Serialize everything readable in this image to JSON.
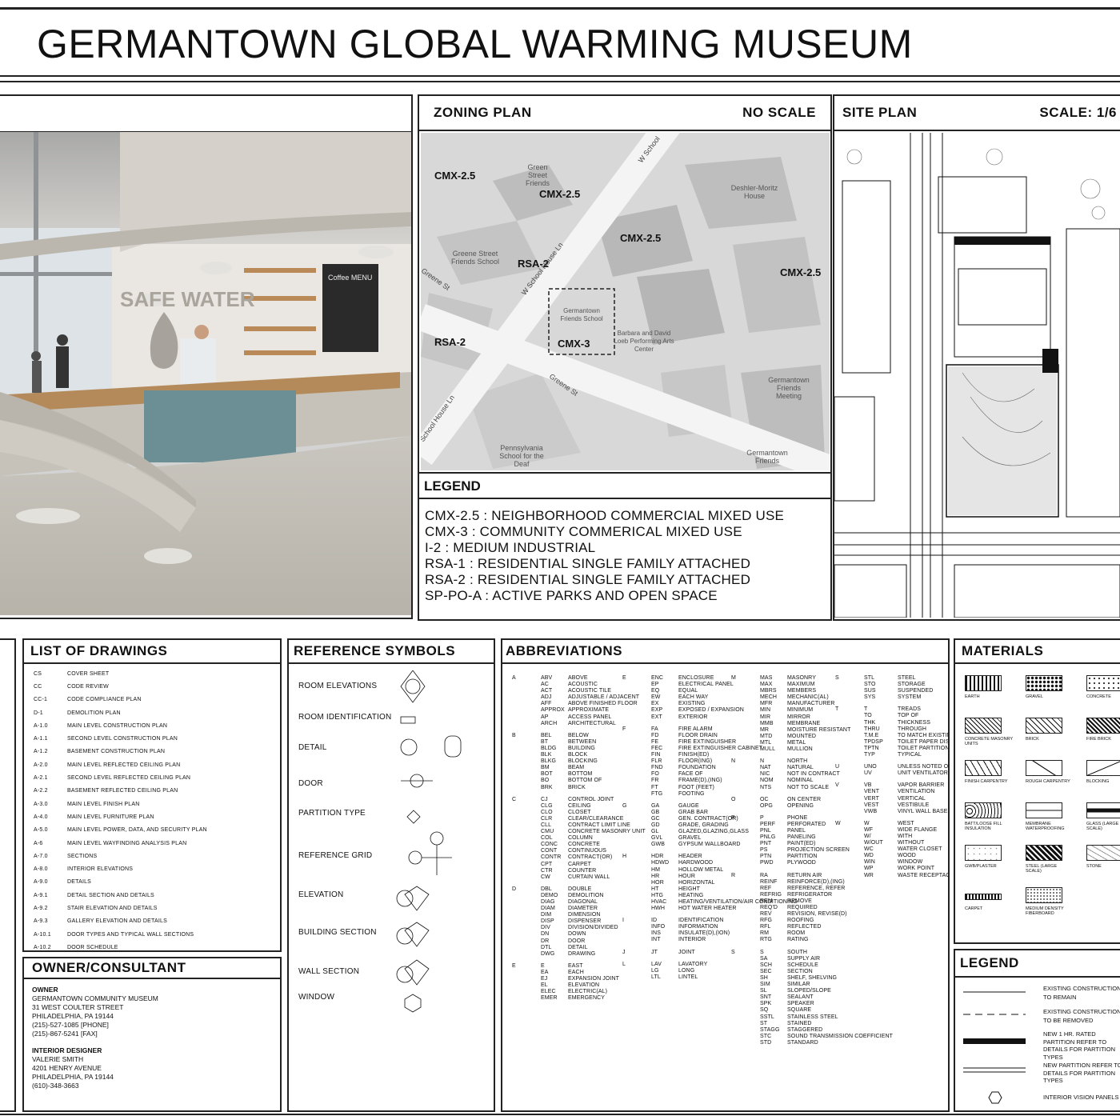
{
  "title": "GERMANTOWN GLOBAL WARMING MUSEUM",
  "zoning": {
    "title": "ZONING PLAN",
    "scale": "NO SCALE",
    "zones": [
      "CMX-2.5",
      "CMX-2.5",
      "CMX-2.5",
      "CMX-2.5",
      "RSA-2",
      "RSA-2",
      "CMX-3"
    ],
    "places": [
      "Green Street Friends",
      "Greene Street Friends School",
      "Deshler-Moritz House",
      "Germantown Friends School",
      "Barbara and David Loeb Performing Arts Center",
      "Germantown Friends Meeting",
      "Germantown Friends",
      "Pennsylvania School for the Deaf"
    ],
    "streets": [
      "W School House Ln",
      "Greene St",
      "Greene St",
      "School House Ln",
      "W School"
    ],
    "legend_title": "LEGEND",
    "legend": [
      "CMX-2.5 : NEIGHBORHOOD COMMERCIAL MIXED USE",
      "CMX-3 : COMMUNITY COMMERICAL MIXED USE",
      "I-2 : MEDIUM INDUSTRIAL",
      "RSA-1 : RESIDENTIAL SINGLE FAMILY ATTACHED",
      "RSA-2 : RESIDENTIAL SINGLE FAMILY ATTACHED",
      "SP-PO-A : ACTIVE PARKS AND OPEN SPACE"
    ]
  },
  "site": {
    "title": "SITE PLAN",
    "scale": "SCALE: 1/6"
  },
  "render": {
    "wall_text": "SAFE WATER",
    "menu_title": "Coffee MENU"
  },
  "drawings": {
    "title": "LIST OF DRAWINGS",
    "rows": [
      [
        "CS",
        "COVER SHEET"
      ],
      [
        "CC",
        "CODE REVIEW"
      ],
      [
        "CC-1",
        "CODE COMPLIANCE PLAN"
      ],
      [
        "D-1",
        "DEMOLITION PLAN"
      ],
      [
        "A-1.0",
        "MAIN LEVEL CONSTRUCTION PLAN"
      ],
      [
        "A-1.1",
        "SECOND LEVEL CONSTRUCTION PLAN"
      ],
      [
        "A-1.2",
        "BASEMENT CONSTRUCTION PLAN"
      ],
      [
        "A-2.0",
        "MAIN LEVEL REFLECTED CEILING PLAN"
      ],
      [
        "A-2.1",
        "SECOND LEVEL REFLECTED CEILING PLAN"
      ],
      [
        "A-2.2",
        "BASEMENT REFLECTED CEILING PLAN"
      ],
      [
        "A-3.0",
        "MAIN LEVEL FINISH PLAN"
      ],
      [
        "A-4.0",
        "MAIN LEVEL FURNITURE PLAN"
      ],
      [
        "A-5.0",
        "MAIN LEVEL POWER, DATA, AND SECURITY PLAN"
      ],
      [
        "A-6",
        "MAIN LEVEL WAYFINDING ANALYSIS PLAN"
      ],
      [
        "A-7.0",
        "SECTIONS"
      ],
      [
        "A-8.0",
        "INTERIOR ELEVATIONS"
      ],
      [
        "A-9.0",
        "DETAILS"
      ],
      [
        "A-9.1",
        "DETAIL SECTION AND DETAILS"
      ],
      [
        "A-9.2",
        "STAIR ELEVATION AND DETAILS"
      ],
      [
        "A-9.3",
        "GALLERY ELEVATION AND DETAILS"
      ],
      [
        "A-10.1",
        "DOOR TYPES AND TYPICAL WALL SECTIONS"
      ],
      [
        "A-10.2",
        "DOOR SCHEDULE"
      ]
    ]
  },
  "owner": {
    "title": "OWNER/CONSULTANT",
    "owner_label": "OWNER",
    "owner_lines": [
      "GERMANTOWN COMMUNITY MUSEUM",
      "31 WEST COULTER STREET",
      "PHILADELPHIA, PA 19144",
      "(215)-527-1085 [PHONE]",
      "(215)-867-5241 [FAX]"
    ],
    "designer_label": "INTERIOR DESIGNER",
    "designer_lines": [
      "VALERIE SMITH",
      "4201 HENRY AVENUE",
      "PHILADELPHIA, PA 19144",
      "(610)-348-3663"
    ]
  },
  "refsymbols": {
    "title": "REFERENCE SYMBOLS",
    "rows": [
      "ROOM ELEVATIONS",
      "ROOM IDENTIFICATION",
      "DETAIL",
      "DOOR",
      "PARTITION TYPE",
      "REFERENCE GRID",
      "ELEVATION",
      "BUILDING SECTION",
      "WALL SECTION",
      "WINDOW"
    ]
  },
  "abbrev": {
    "title": "ABBREVIATIONS",
    "columns": [
      [
        {
          "letter": "A",
          "items": [
            [
              "ABV",
              "ABOVE"
            ],
            [
              "AC",
              "ACOUSTIC"
            ],
            [
              "ACT",
              "ACOUSTIC TILE"
            ],
            [
              "ADJ",
              "ADJUSTABLE / ADJACENT"
            ],
            [
              "AFF",
              "ABOVE FINISHED FLOOR"
            ],
            [
              "APPROX",
              "APPROXIMATE"
            ],
            [
              "AP",
              "ACCESS PANEL"
            ],
            [
              "ARCH",
              "ARCHITECTURAL"
            ]
          ]
        },
        {
          "letter": "B",
          "items": [
            [
              "BEL",
              "BELOW"
            ],
            [
              "BT",
              "BETWEEN"
            ],
            [
              "BLDG",
              "BUILDING"
            ],
            [
              "BLK",
              "BLOCK"
            ],
            [
              "BLKG",
              "BLOCKING"
            ],
            [
              "BM",
              "BEAM"
            ],
            [
              "BOT",
              "BOTTOM"
            ],
            [
              "BO",
              "BOTTOM OF"
            ],
            [
              "BRK",
              "BRICK"
            ]
          ]
        },
        {
          "letter": "C",
          "items": [
            [
              "CJ",
              "CONTROL JOINT"
            ],
            [
              "CLG",
              "CEILING"
            ],
            [
              "CLO",
              "CLOSET"
            ],
            [
              "CLR",
              "CLEAR/CLEARANCE"
            ],
            [
              "CLL",
              "CONTRACT LIMIT LINE"
            ],
            [
              "CMU",
              "CONCRETE MASONRY UNIT"
            ],
            [
              "COL",
              "COLUMN"
            ],
            [
              "CONC",
              "CONCRETE"
            ],
            [
              "CONT",
              "CONTINUOUS"
            ],
            [
              "CONTR",
              "CONTRACT(OR)"
            ],
            [
              "CPT",
              "CARPET"
            ],
            [
              "CTR",
              "COUNTER"
            ],
            [
              "CW",
              "CURTAIN WALL"
            ]
          ]
        },
        {
          "letter": "D",
          "items": [
            [
              "DBL",
              "DOUBLE"
            ],
            [
              "DEMO",
              "DEMOLITION"
            ],
            [
              "DIAG",
              "DIAGONAL"
            ],
            [
              "DIAM",
              "DIAMETER"
            ],
            [
              "DIM",
              "DIMENSION"
            ],
            [
              "DISP",
              "DISPENSER"
            ],
            [
              "DIV",
              "DIVISION/DIVIDED"
            ],
            [
              "DN",
              "DOWN"
            ],
            [
              "DR",
              "DOOR"
            ],
            [
              "DTL",
              "DETAIL"
            ],
            [
              "DWG",
              "DRAWING"
            ]
          ]
        },
        {
          "letter": "E",
          "items": [
            [
              "E",
              "EAST"
            ],
            [
              "EA",
              "EACH"
            ],
            [
              "EJ",
              "EXPANSION JOINT"
            ],
            [
              "EL",
              "ELEVATION"
            ],
            [
              "ELEC",
              "ELECTRIC(AL)"
            ],
            [
              "EMER",
              "EMERGENCY"
            ]
          ]
        }
      ],
      [
        {
          "letter": "E",
          "items": [
            [
              "ENC",
              "ENCLOSURE"
            ],
            [
              "EP",
              "ELECTRICAL PANEL"
            ],
            [
              "EQ",
              "EQUAL"
            ],
            [
              "EW",
              "EACH WAY"
            ],
            [
              "EX",
              "EXISTING"
            ],
            [
              "EXP",
              "EXPOSED / EXPANSION"
            ],
            [
              "EXT",
              "EXTERIOR"
            ]
          ]
        },
        {
          "letter": "F",
          "items": [
            [
              "FA",
              "FIRE ALARM"
            ],
            [
              "FD",
              "FLOOR DRAIN"
            ],
            [
              "FE",
              "FIRE EXTINGUISHER"
            ],
            [
              "FEC",
              "FIRE EXTINGUISHER CABINET"
            ],
            [
              "FIN",
              "FINISH(ED)"
            ],
            [
              "FLR",
              "FLOOR(ING)"
            ],
            [
              "FND",
              "FOUNDATION"
            ],
            [
              "FO",
              "FACE OF"
            ],
            [
              "FR",
              "FRAME(D),(ING)"
            ],
            [
              "FT",
              "FOOT (FEET)"
            ],
            [
              "FTG",
              "FOOTING"
            ]
          ]
        },
        {
          "letter": "G",
          "items": [
            [
              "GA",
              "GAUGE"
            ],
            [
              "GB",
              "GRAB BAR"
            ],
            [
              "GC",
              "GEN. CONTRACT(OR)"
            ],
            [
              "GD",
              "GRADE, GRADING"
            ],
            [
              "GL",
              "GLAZED,GLAZING,GLASS"
            ],
            [
              "GVL",
              "GRAVEL"
            ],
            [
              "GWB",
              "GYPSUM WALLBOARD"
            ]
          ]
        },
        {
          "letter": "H",
          "items": [
            [
              "HDR",
              "HEADER"
            ],
            [
              "HDWD",
              "HARDWOOD"
            ],
            [
              "HM",
              "HOLLOW METAL"
            ],
            [
              "HR",
              "HOUR"
            ],
            [
              "HOR",
              "HORIZONTAL"
            ],
            [
              "HT",
              "HEIGHT"
            ],
            [
              "HTG",
              "HEATING"
            ],
            [
              "HVAC",
              "HEATING/VENTILATION/AIR CONDITIONING"
            ],
            [
              "HWH",
              "HOT WATER HEATER"
            ]
          ]
        },
        {
          "letter": "I",
          "items": [
            [
              "ID",
              "IDENTIFICATION"
            ],
            [
              "INFO",
              "INFORMATION"
            ],
            [
              "INS",
              "INSULATE(D),(ION)"
            ],
            [
              "INT",
              "INTERIOR"
            ]
          ]
        },
        {
          "letter": "J",
          "items": [
            [
              "JT",
              "JOINT"
            ]
          ]
        },
        {
          "letter": "L",
          "items": [
            [
              "LAV",
              "LAVATORY"
            ],
            [
              "LG",
              "LONG"
            ],
            [
              "LTL",
              "LINTEL"
            ]
          ]
        }
      ],
      [
        {
          "letter": "M",
          "items": [
            [
              "MAS",
              "MASONRY"
            ],
            [
              "MAX",
              "MAXIMUM"
            ],
            [
              "MBRS",
              "MEMBERS"
            ],
            [
              "MECH",
              "MECHANIC(AL)"
            ],
            [
              "MFR",
              "MANUFACTURER"
            ],
            [
              "MIN",
              "MINIMUM"
            ],
            [
              "MIR",
              "MIRROR"
            ],
            [
              "MMB",
              "MEMBRANE"
            ],
            [
              "MR",
              "MOISTURE RESISTANT"
            ],
            [
              "MTD",
              "MOUNTED"
            ],
            [
              "MTL",
              "METAL"
            ],
            [
              "MULL",
              "MULLION"
            ]
          ]
        },
        {
          "letter": "N",
          "items": [
            [
              "N",
              "NORTH"
            ],
            [
              "NAT",
              "NATURAL"
            ],
            [
              "NIC",
              "NOT IN CONTRACT"
            ],
            [
              "NOM",
              "NOMINAL"
            ],
            [
              "NTS",
              "NOT TO SCALE"
            ]
          ]
        },
        {
          "letter": "O",
          "items": [
            [
              "OC",
              "ON CENTER"
            ],
            [
              "OPG",
              "OPENING"
            ]
          ]
        },
        {
          "letter": "P",
          "items": [
            [
              "P",
              "PHONE"
            ],
            [
              "PERF",
              "PERFORATED"
            ],
            [
              "PNL",
              "PANEL"
            ],
            [
              "PNLG",
              "PANELING"
            ],
            [
              "PNT",
              "PAINT(ED)"
            ],
            [
              "PS",
              "PROJECTION SCREEN"
            ],
            [
              "PTN",
              "PARTITION"
            ],
            [
              "PWD",
              "PLYWOOD"
            ]
          ]
        },
        {
          "letter": "R",
          "items": [
            [
              "RA",
              "RETURN AIR"
            ],
            [
              "REINF",
              "REINFORCE(D),(ING)"
            ],
            [
              "REF",
              "REFERENCE, REFER"
            ],
            [
              "REFRIG",
              "REFRIGERATOR"
            ],
            [
              "REM",
              "REMOVE"
            ],
            [
              "REQ'D",
              "REQUIRED"
            ],
            [
              "REV",
              "REVISION, REVISE(D)"
            ],
            [
              "RFG",
              "ROOFING"
            ],
            [
              "RFL",
              "REFLECTED"
            ],
            [
              "RM",
              "ROOM"
            ],
            [
              "RTG",
              "RATING"
            ]
          ]
        },
        {
          "letter": "S",
          "items": [
            [
              "S",
              "SOUTH"
            ],
            [
              "SA",
              "SUPPLY AIR"
            ],
            [
              "SCH",
              "SCHEDULE"
            ],
            [
              "SEC",
              "SECTION"
            ],
            [
              "SH",
              "SHELF, SHELVING"
            ],
            [
              "SIM",
              "SIMILAR"
            ],
            [
              "SL",
              "SLOPED/SLOPE"
            ],
            [
              "SNT",
              "SEALANT"
            ],
            [
              "SPK",
              "SPEAKER"
            ],
            [
              "SQ",
              "SQUARE"
            ],
            [
              "SSTL",
              "STAINLESS STEEL"
            ],
            [
              "ST",
              "STAINED"
            ],
            [
              "STAGG",
              "STAGGERED"
            ],
            [
              "STC",
              "SOUND TRANSMISSION COEFFICIENT"
            ],
            [
              "STD",
              "STANDARD"
            ]
          ]
        }
      ],
      [
        {
          "letter": "S",
          "items": [
            [
              "STL",
              "STEEL"
            ],
            [
              "STO",
              "STORAGE"
            ],
            [
              "SUS",
              "SUSPENDED"
            ],
            [
              "SYS",
              "SYSTEM"
            ]
          ]
        },
        {
          "letter": "T",
          "items": [
            [
              "T",
              "TREADS"
            ],
            [
              "TO",
              "TOP OF"
            ],
            [
              "THK",
              "THICKNESS"
            ],
            [
              "THRU",
              "THROUGH"
            ],
            [
              "T.M.E",
              "TO MATCH EXISTING"
            ],
            [
              "TPDSP",
              "TOILET PAPER DISPENSER"
            ],
            [
              "TPTN",
              "TOILET PARTITION"
            ],
            [
              "TYP",
              "TYPICAL"
            ]
          ]
        },
        {
          "letter": "U",
          "items": [
            [
              "UNO",
              "UNLESS NOTED OTHERWISE"
            ],
            [
              "UV",
              "UNIT VENTILATOR"
            ]
          ]
        },
        {
          "letter": "V",
          "items": [
            [
              "VB",
              "VAPOR BARRIER"
            ],
            [
              "VENT",
              "VENTILATION"
            ],
            [
              "VERT",
              "VERTICAL"
            ],
            [
              "VEST",
              "VESTIBULE"
            ],
            [
              "VWB",
              "VINYL WALL BASE"
            ]
          ]
        },
        {
          "letter": "W",
          "items": [
            [
              "W",
              "WEST"
            ],
            [
              "WF",
              "WIDE FLANGE"
            ],
            [
              "W/",
              "WITH"
            ],
            [
              "W/OUT",
              "WITHOUT"
            ],
            [
              "WC",
              "WATER CLOSET"
            ],
            [
              "WD",
              "WOOD"
            ],
            [
              "WIN",
              "WINDOW"
            ],
            [
              "WP",
              "WORK POINT"
            ],
            [
              "WR",
              "WASTE RECEPTACLE"
            ]
          ]
        }
      ]
    ]
  },
  "materials": {
    "title": "MATERIALS",
    "items": [
      "EARTH",
      "GRAVEL",
      "CONCRETE",
      "CONCRETE MASONRY UNITS",
      "BRICK",
      "FIRE BRICK",
      "FINISH CARPENTRY",
      "ROUGH CARPENTRY",
      "BLOCKING",
      "BATT/LOOSE FILL INSULATION",
      "MEMBRANE WATERPROOFING",
      "GLASS (LARGE SCALE)",
      "GWB/PLASTER",
      "STEEL (LARGE SCALE)",
      "STONE",
      "CARPET",
      "MEDIUM DENSITY FIBERBOARD"
    ]
  },
  "legend2": {
    "title": "LEGEND",
    "items": [
      "EXISTING CONSTRUCTION TO REMAIN",
      "EXISTING CONSTRUCTION TO BE REMOVED",
      "NEW 1 HR. RATED PARTITION REFER TO DETAILS FOR PARTITION TYPES",
      "NEW PARTITION REFER TO DETAILS FOR PARTITION TYPES",
      "INTERIOR VISION PANELS"
    ]
  }
}
